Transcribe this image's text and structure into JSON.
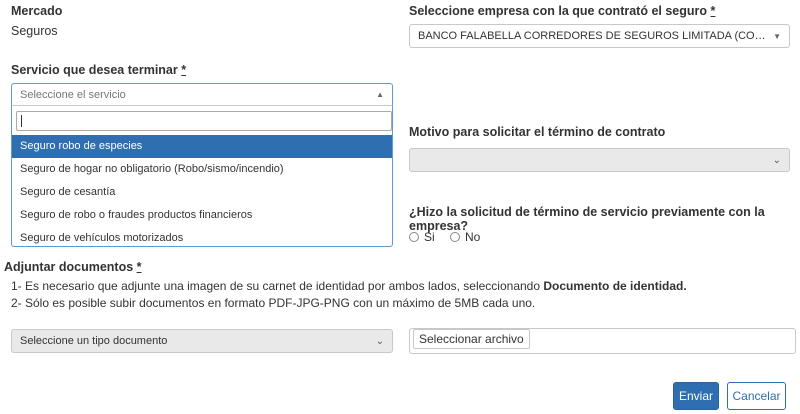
{
  "mercado": {
    "label": "Mercado",
    "value": "Seguros"
  },
  "empresa": {
    "label": "Seleccione empresa con la que contrató el seguro",
    "required_mark": "*",
    "selected": "BANCO FALABELLA CORREDORES DE SEGUROS LIMITADA (CONTRATADO SO..."
  },
  "servicio": {
    "label": "Servicio que desea terminar",
    "required_mark": "*",
    "placeholder": "Seleccione el servicio",
    "search_value": "",
    "options": [
      "Seguro robo de especies",
      "Seguro de hogar no obligatorio (Robo/sismo/incendio)",
      "Seguro de cesantía",
      "Seguro de robo o fraudes productos financieros",
      "Seguro de vehículos motorizados"
    ],
    "highlighted_index": 0
  },
  "motivo": {
    "label": "Motivo para solicitar el término de contrato",
    "selected": ""
  },
  "previa": {
    "question": "¿Hizo la solicitud de término de servicio previamente con la empresa?",
    "opt_yes": "Si",
    "opt_no": "No"
  },
  "adjuntar": {
    "label": "Adjuntar documentos",
    "required_mark": "*",
    "note1_prefix": "1- Es necesario que adjunte una imagen de su carnet de identidad por ambos lados, seleccionando ",
    "note1_bold": "Documento de identidad.",
    "note2": "2- Sólo es posible subir documentos en formato PDF-JPG-PNG con un máximo de 5MB cada uno.",
    "tipo_placeholder": "Seleccione un tipo documento",
    "file_button": "Seleccionar archivo"
  },
  "actions": {
    "submit": "Enviar",
    "cancel": "Cancelar"
  },
  "colors": {
    "primary": "#2f6fb1",
    "focus_border": "#5b9bd5",
    "disabled_bg": "#e9e9e9"
  }
}
